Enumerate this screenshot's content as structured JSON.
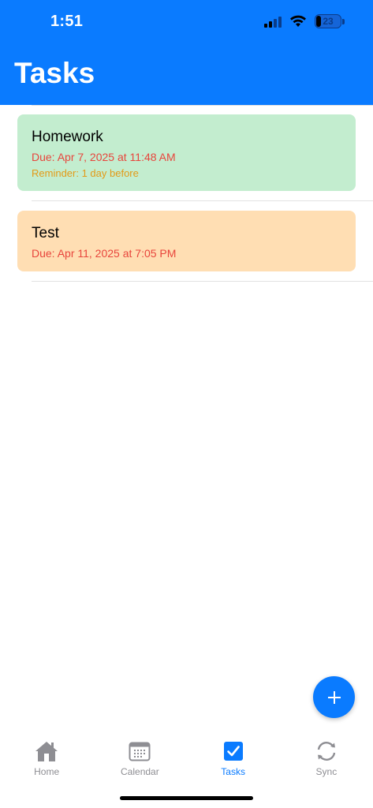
{
  "status_bar": {
    "time": "1:51",
    "battery": "23"
  },
  "header": {
    "title": "Tasks",
    "background": "#0a7bff"
  },
  "tasks": [
    {
      "title": "Homework",
      "due": "Due: Apr 7, 2025 at 11:48 AM",
      "reminder": "Reminder: 1 day before",
      "color": "#c3edcf"
    },
    {
      "title": "Test",
      "due": "Due: Apr 11, 2025 at 7:05 PM",
      "color": "#ffdeb3"
    }
  ],
  "fab": {
    "icon": "plus-icon",
    "label": "+"
  },
  "tab_bar": {
    "items": [
      {
        "label": "Home",
        "icon": "home-icon",
        "active": false
      },
      {
        "label": "Calendar",
        "icon": "calendar-icon",
        "active": false
      },
      {
        "label": "Tasks",
        "icon": "checkbox-icon",
        "active": true
      },
      {
        "label": "Sync",
        "icon": "sync-icon",
        "active": false
      }
    ],
    "active_color": "#0a7bff",
    "inactive_color": "#8e8e93"
  }
}
